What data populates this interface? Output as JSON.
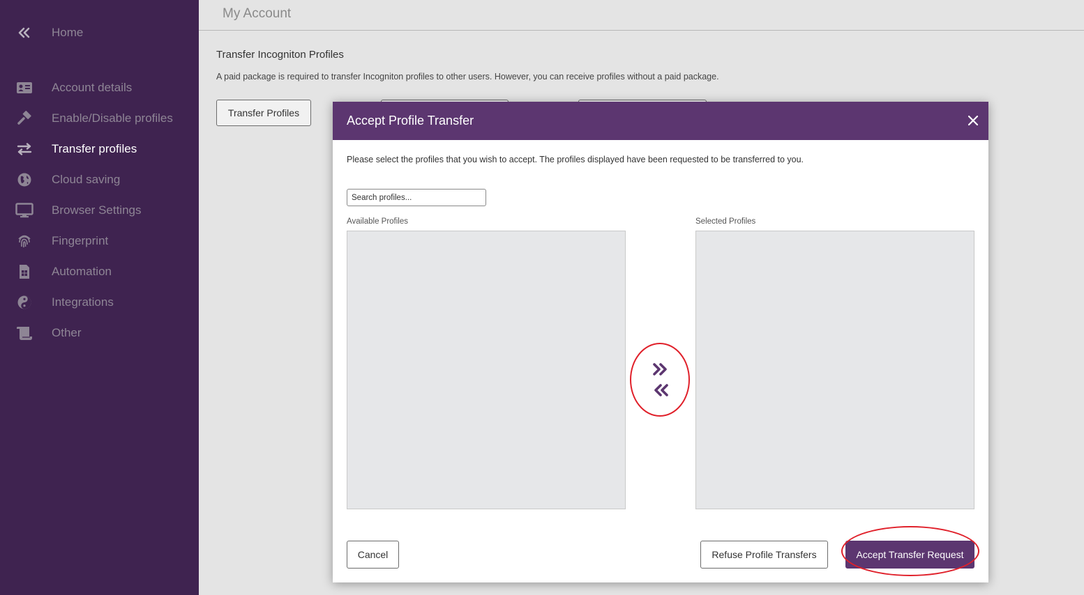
{
  "sidebar": {
    "home_label": "Home",
    "items": [
      {
        "label": "Account details",
        "icon": "id-card-icon"
      },
      {
        "label": "Enable/Disable profiles",
        "icon": "hammer-icon"
      },
      {
        "label": "Transfer profiles",
        "icon": "transfer-arrows-icon",
        "active": true
      },
      {
        "label": "Cloud saving",
        "icon": "globe-icon"
      },
      {
        "label": "Browser Settings",
        "icon": "monitor-icon"
      },
      {
        "label": "Fingerprint",
        "icon": "fingerprint-icon"
      },
      {
        "label": "Automation",
        "icon": "sim-card-icon"
      },
      {
        "label": "Integrations",
        "icon": "yin-yang-icon"
      },
      {
        "label": "Other",
        "icon": "scroll-icon"
      }
    ]
  },
  "header": {
    "title": "My Account"
  },
  "main": {
    "section_title": "Transfer Incogniton Profiles",
    "description": "A paid package is required to transfer Incogniton profiles to other users. However, you can receive profiles without a paid package.",
    "transfer_button_label": "Transfer Profiles"
  },
  "modal": {
    "title": "Accept Profile Transfer",
    "instructions": "Please select the profiles that you wish to accept. The profiles displayed have been requested to be transferred to you.",
    "search_placeholder": "Search profiles...",
    "available_label": "Available Profiles",
    "selected_label": "Selected Profiles",
    "available_profiles": [],
    "selected_profiles": [],
    "cancel_label": "Cancel",
    "refuse_label": "Refuse Profile Transfers",
    "accept_label": "Accept Transfer Request"
  },
  "colors": {
    "sidebar_bg": "#3f2350",
    "accent": "#5c3670",
    "annotation": "#e0202a"
  }
}
